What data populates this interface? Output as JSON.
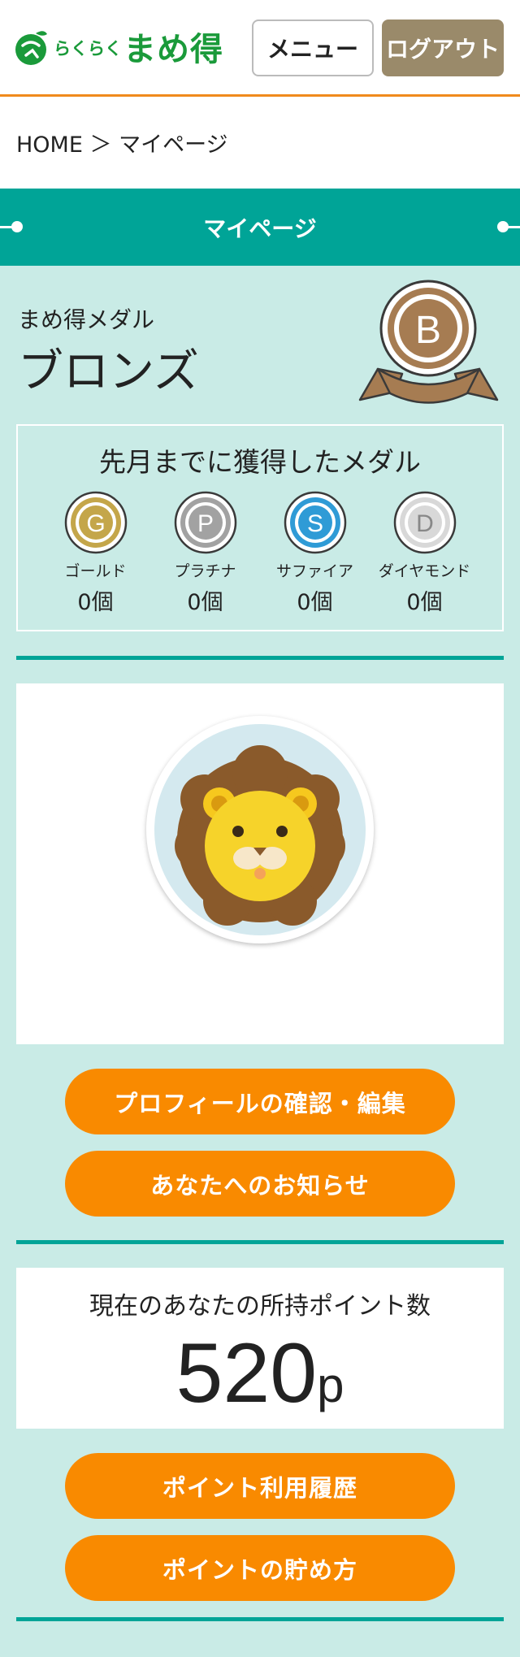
{
  "header": {
    "logo_small": "らくらく",
    "logo_big": "まめ得",
    "menu_label": "メニュー",
    "logout_label": "ログアウト"
  },
  "breadcrumb": {
    "text": "HOME ＞ マイページ"
  },
  "page_title": "マイページ",
  "medal": {
    "label": "まめ得メダル",
    "rank": "ブロンズ",
    "badge_letter": "B"
  },
  "medal_history": {
    "title": "先月までに獲得したメダル",
    "items": [
      {
        "letter": "G",
        "name": "ゴールド",
        "count": "0個",
        "color": "#c4a64a"
      },
      {
        "letter": "P",
        "name": "プラチナ",
        "count": "0個",
        "color": "#a2a2a2"
      },
      {
        "letter": "S",
        "name": "サファイア",
        "count": "0個",
        "color": "#2f9bd6"
      },
      {
        "letter": "D",
        "name": "ダイヤモンド",
        "count": "0個",
        "color": "#d8d8d8"
      }
    ]
  },
  "buttons": {
    "profile": "プロフィールの確認・編集",
    "notices": "あなたへのお知らせ",
    "point_history": "ポイント利用履歴",
    "point_earn": "ポイントの貯め方"
  },
  "points": {
    "label": "現在のあなたの所持ポイント数",
    "value": "520",
    "unit": "p"
  },
  "colors": {
    "teal": "#00a497",
    "orange": "#f98a00",
    "mint_bg": "#c9ebe6",
    "bronze": "#a67c52",
    "logo_green": "#1a9a3a"
  }
}
